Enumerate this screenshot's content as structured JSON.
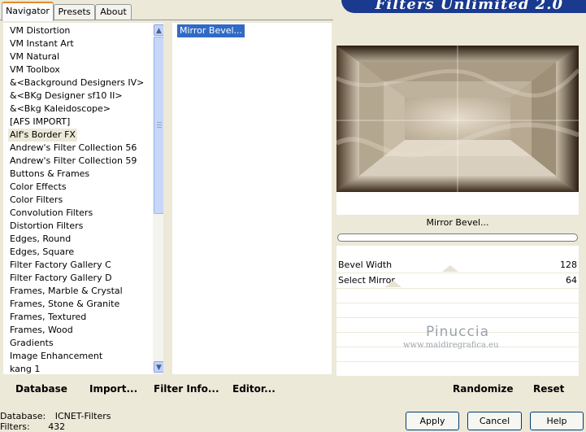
{
  "tabs": [
    "Navigator",
    "Presets",
    "About"
  ],
  "banner_title": "Filters Unlimited 2.0",
  "categories": [
    "VM Distortion",
    "VM Instant Art",
    "VM Natural",
    "VM Toolbox",
    "&<Background Designers IV>",
    "&<BKg Designer sf10 II>",
    "&<Bkg Kaleidoscope>",
    "[AFS IMPORT]",
    "Alf's Border FX",
    "Andrew's Filter Collection 56",
    "Andrew's Filter Collection 59",
    "Buttons & Frames",
    "Color Effects",
    "Color Filters",
    "Convolution Filters",
    "Distortion Filters",
    "Edges, Round",
    "Edges, Square",
    "Filter Factory Gallery C",
    "Filter Factory Gallery D",
    "Frames, Marble & Crystal",
    "Frames, Stone & Granite",
    "Frames, Textured",
    "Frames, Wood",
    "Gradients",
    "Image Enhancement",
    "kang 1"
  ],
  "selected_category": "Alf's Border FX",
  "filters": [
    "Mirror Bevel..."
  ],
  "toolbar": {
    "database": "Database",
    "import": "Import...",
    "filter_info": "Filter Info...",
    "editor": "Editor...",
    "randomize": "Randomize",
    "reset": "Reset"
  },
  "filter_name": "Mirror Bevel...",
  "params": [
    {
      "label": "Bevel Width",
      "value": "128",
      "level": 0.5
    },
    {
      "label": "Select Mirror",
      "value": "64",
      "level": 0.25
    }
  ],
  "watermark": {
    "name": "Pinuccia",
    "site": "www.maidiregrafica.eu"
  },
  "status": {
    "database_label": "Database:",
    "database_value": "ICNET-Filters",
    "filters_label": "Filters:",
    "filters_value": "432"
  },
  "buttons": {
    "apply": "Apply",
    "cancel": "Cancel",
    "help": "Help"
  }
}
